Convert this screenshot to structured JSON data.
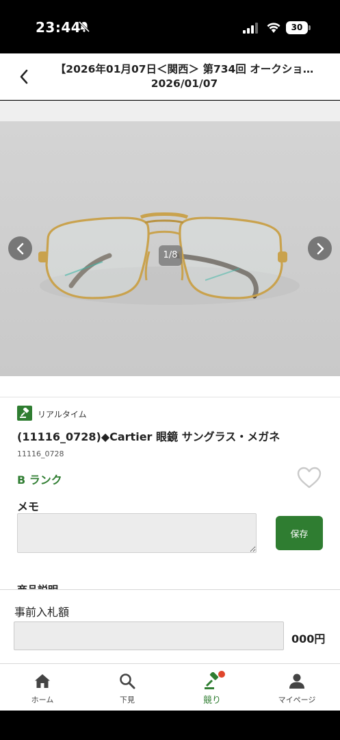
{
  "status_bar": {
    "time": "23:44",
    "battery": "30"
  },
  "header": {
    "title_line1": "【2026年01月07日＜関西＞ 第734回 オークショ…",
    "title_line2": "2026/01/07"
  },
  "carousel": {
    "counter": "1/8"
  },
  "product": {
    "realtime_label": "リアルタイム",
    "title": "(11116_0728)◆Cartier 眼鏡 サングラス・メガネ",
    "code": "11116_0728",
    "rank": "B ランク",
    "memo_label": "メモ",
    "memo_value": "",
    "save_label": "保存",
    "description_heading": "商品説明"
  },
  "bid": {
    "label": "事前入札額",
    "value": "",
    "unit": "000円"
  },
  "tabs": [
    {
      "label": "ホーム",
      "icon": "home-icon"
    },
    {
      "label": "下見",
      "icon": "search-icon"
    },
    {
      "label": "競り",
      "icon": "gavel-icon",
      "active": true,
      "notification": true
    },
    {
      "label": "マイページ",
      "icon": "person-icon"
    }
  ],
  "colors": {
    "accent": "#2f7d31",
    "notification": "#e0452b"
  }
}
